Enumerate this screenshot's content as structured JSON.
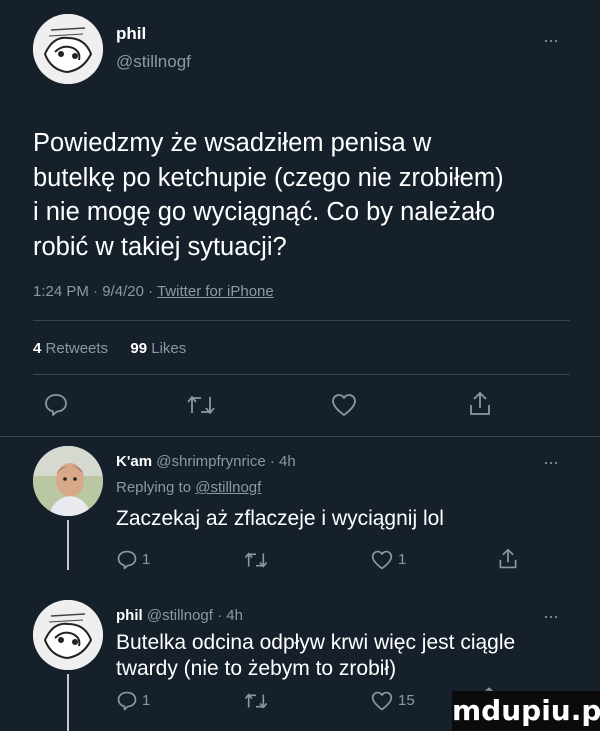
{
  "tweet": {
    "display_name": "phil",
    "handle": "@stillnogf",
    "body_lines": [
      "Powiedzmy że wsadziłem penisa w",
      "butelkę po ketchupie (czego nie zrobiłem)",
      "i nie mogę go wyciągnąć. Co by należało",
      "robić w takiej sytuacji?"
    ],
    "time": "1:24 PM",
    "date": "9/4/20",
    "source": "Twitter for iPhone",
    "retweets_count": "4",
    "retweets_label": "Retweets",
    "likes_count": "99",
    "likes_label": "Likes",
    "more": "···",
    "sep": "·"
  },
  "replies": [
    {
      "display_name": "K'am",
      "handle": "@shrimpfrynrice",
      "age": "4h",
      "replying_to_label": "Replying to",
      "replying_to_handle": "@stillnogf",
      "text": "Zaczekaj aż zflaczeje i wyciągnij lol",
      "reply_count": "1",
      "like_count": "1",
      "more": "···"
    },
    {
      "display_name": "phil",
      "handle": "@stillnogf",
      "age": "4h",
      "text_lines": [
        "Butelka odcina odpływ krwi więc jest ciągle",
        "twardy (nie to żebym to zrobił)"
      ],
      "reply_count": "1",
      "like_count": "15",
      "more": "···"
    }
  ],
  "watermark": "mdupiu.pl",
  "colors": {
    "background": "#15202b",
    "text": "#ffffff",
    "secondary": "#8899a6",
    "divider": "#38444d"
  }
}
